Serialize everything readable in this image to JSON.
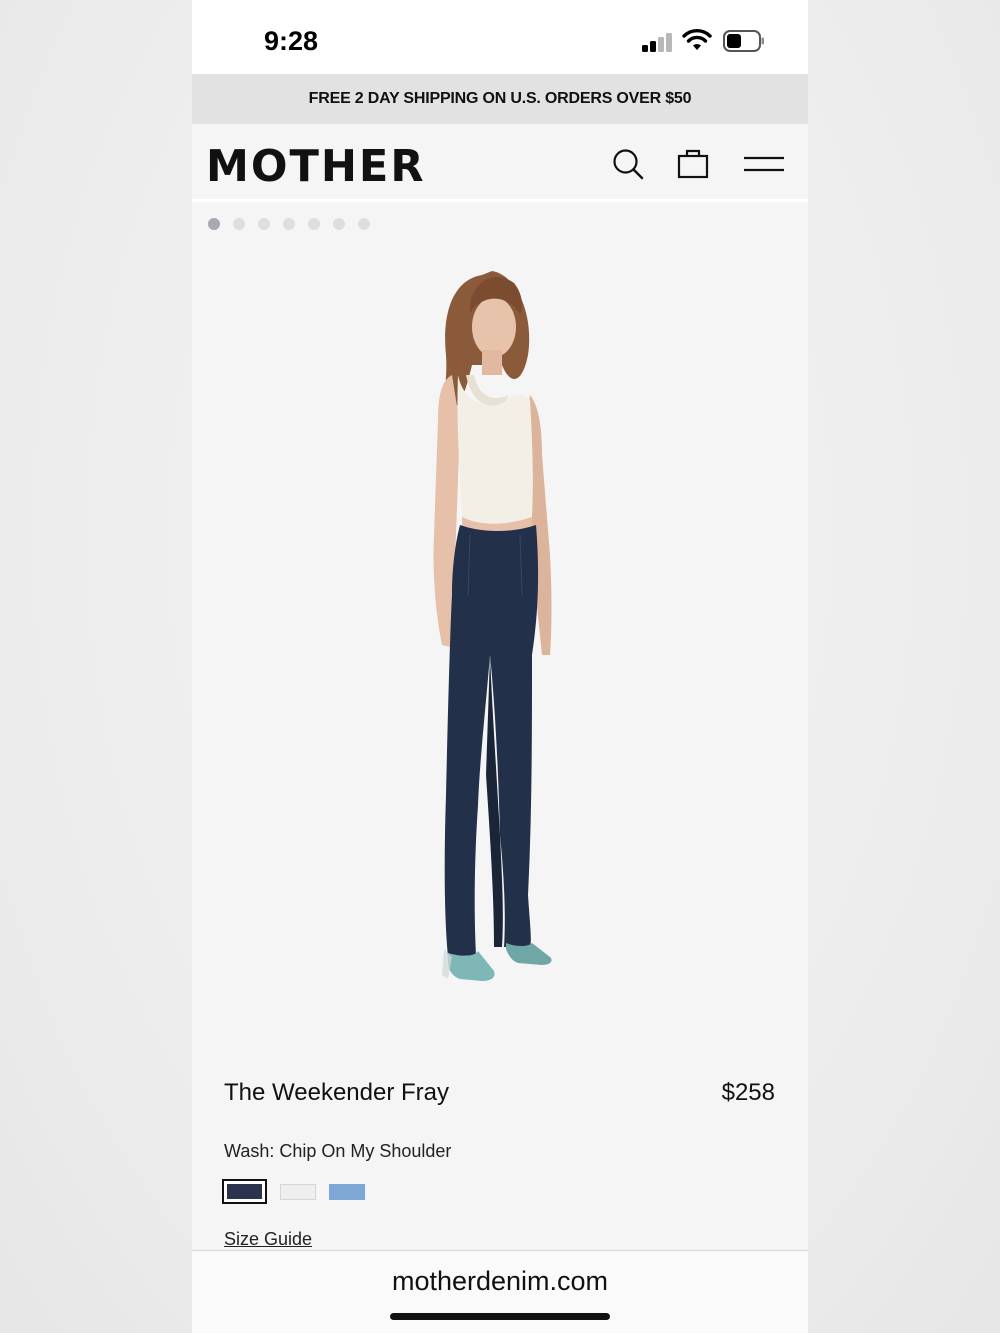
{
  "status_bar": {
    "time": "9:28",
    "icons": [
      "cellular-signal-icon",
      "wifi-icon",
      "battery-icon"
    ]
  },
  "promo": {
    "text": "FREE 2 DAY SHIPPING ON U.S. ORDERS OVER $50"
  },
  "header": {
    "logo": "MOTHER",
    "icons": [
      "search-icon",
      "shopping-bag-icon",
      "hamburger-menu-icon"
    ]
  },
  "carousel": {
    "dot_count": 7,
    "active_index": 0
  },
  "product": {
    "name": "The Weekender Fray",
    "price": "$258",
    "wash_label": "Wash: Chip On My Shoulder",
    "swatches": [
      {
        "color": "#2a344c",
        "selected": true
      },
      {
        "color": "#efefef",
        "selected": false
      },
      {
        "color": "#7ea7d6",
        "selected": false
      }
    ],
    "size_guide": "Size Guide"
  },
  "browser": {
    "url": "motherdenim.com"
  },
  "colors": {
    "promo_bg": "#e2e2e2",
    "page_bg": "#f5f5f5",
    "denim": "#23304a",
    "top": "#f2efe6",
    "boots": "#7fb7b6"
  }
}
